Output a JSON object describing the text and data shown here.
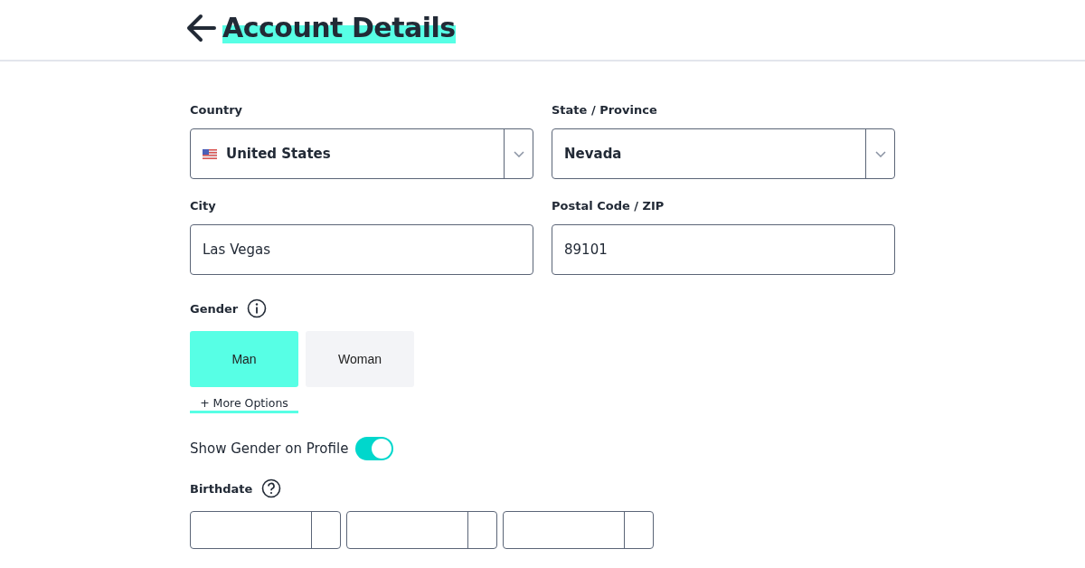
{
  "header": {
    "title": "Account Details"
  },
  "rows": [
    [
      {
        "kind": "flag_select",
        "label": "Country",
        "value": "United States"
      },
      {
        "kind": "select",
        "label": "State / Province",
        "value": "Nevada"
      }
    ],
    [
      {
        "kind": "text",
        "label": "City",
        "value": "Las Vegas"
      },
      {
        "kind": "text",
        "label": "Postal Code / ZIP",
        "value": "89101"
      }
    ]
  ],
  "gender": {
    "label": "Gender",
    "options": [
      {
        "label": "Man",
        "selected": true
      },
      {
        "label": "Woman",
        "selected": false
      }
    ],
    "more_options": "+ More Options"
  },
  "show_gender": {
    "label": "Show Gender on Profile",
    "on": true
  },
  "birthdate": {
    "label": "Birthdate",
    "dropdowns": [
      {
        "kind": "select"
      },
      {
        "kind": "select"
      },
      {
        "kind": "select"
      }
    ]
  }
}
